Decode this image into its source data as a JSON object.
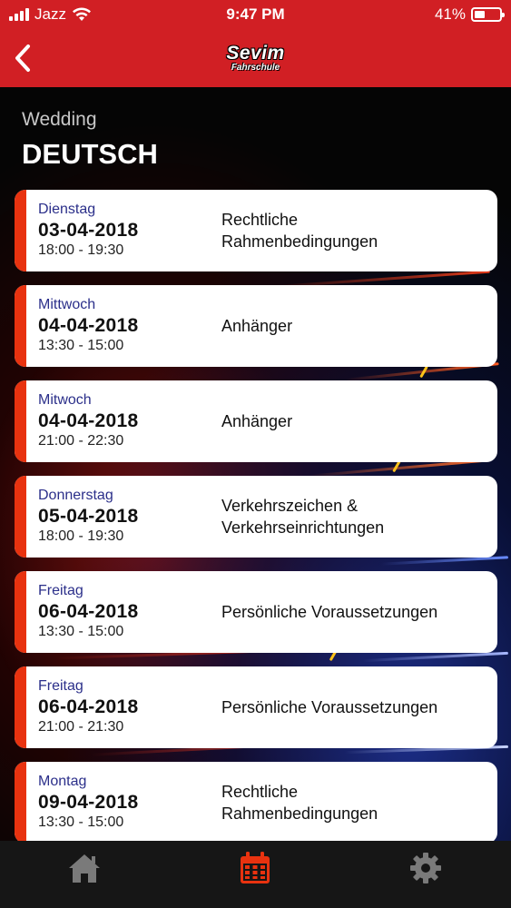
{
  "status_bar": {
    "carrier": "Jazz",
    "time": "9:47 PM",
    "battery_percent": "41%",
    "battery_level": 0.41
  },
  "header": {
    "back_icon": "chevron-left-icon",
    "logo_title": "Sevim",
    "logo_subtitle": "Fahrschule",
    "color": "#d11f24"
  },
  "section": {
    "location": "Wedding",
    "language": "DEUTSCH"
  },
  "lessons": [
    {
      "day": "Dienstag",
      "date": "03-04-2018",
      "time": "18:00 - 19:30",
      "course": "Rechtliche\nRahmenbedingungen"
    },
    {
      "day": "Mittwoch",
      "date": "04-04-2018",
      "time": "13:30 - 15:00",
      "course": "Anhänger"
    },
    {
      "day": "Mitwoch",
      "date": "04-04-2018",
      "time": "21:00 - 22:30",
      "course": "Anhänger"
    },
    {
      "day": "Donnerstag",
      "date": "05-04-2018",
      "time": "18:00 - 19:30",
      "course": "Verkehrszeichen &\nVerkehrseinrichtungen"
    },
    {
      "day": "Freitag",
      "date": "06-04-2018",
      "time": "13:30 - 15:00",
      "course": "Persönliche Voraussetzungen"
    },
    {
      "day": "Freitag",
      "date": "06-04-2018",
      "time": "21:00 - 21:30",
      "course": "Persönliche Voraussetzungen"
    },
    {
      "day": "Montag",
      "date": "09-04-2018",
      "time": "13:30 - 15:00",
      "course": "Rechtliche\nRahmenbedingungen"
    }
  ],
  "tabbar": {
    "items": [
      {
        "icon": "home-icon",
        "active": false
      },
      {
        "icon": "calendar-icon",
        "active": true
      },
      {
        "icon": "gear-icon",
        "active": false
      }
    ],
    "active_color": "#e8320f",
    "inactive_color": "#7a7a7a"
  }
}
